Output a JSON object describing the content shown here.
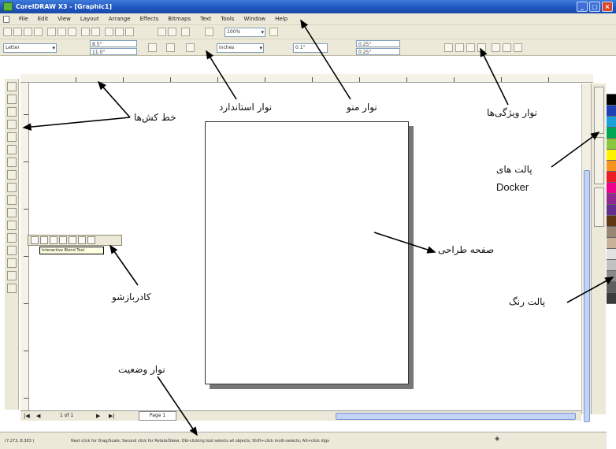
{
  "window": {
    "title": "CorelDRAW X3 - [Graphic1]",
    "controls": [
      "_",
      "□",
      "×"
    ]
  },
  "menu": [
    "File",
    "Edit",
    "View",
    "Layout",
    "Arrange",
    "Effects",
    "Bitmaps",
    "Text",
    "Tools",
    "Window",
    "Help"
  ],
  "standard_toolbar": {
    "zoom": "100%"
  },
  "property_bar": {
    "paper": "Letter",
    "width": "8.5\"",
    "height": "11.0\"",
    "units": "inches",
    "nudge": "0.1\"",
    "dup_x": "0.25\"",
    "dup_y": "0.25\""
  },
  "flyout_tooltip": "Interactive Blend Tool",
  "page_nav": {
    "count": "1 of 1",
    "tab": "Page 1"
  },
  "status": {
    "coords": "(7.273, 8.383 )",
    "hint": "Next click for Drag/Scale; Second click for Rotate/Skew; Dbl-clicking tool selects all objects; Shift+click multi-selects; Alt+click digs"
  },
  "annotations": {
    "toolbox": "خط کش‌ها",
    "standard_toolbar": "نوار استاندارد",
    "menu_bar": "نوار منو",
    "property_bar": "نوار ویژگی‌ها",
    "docker_line1": "پالت های",
    "docker_line2": "Docker",
    "drawing_page": "صفحه طراحی",
    "flyout": "کادربازشو",
    "color_palette": "پالت رنگ",
    "status_bar": "نوار وضعیت"
  },
  "palette_colors": [
    "#ffffff",
    "#000000",
    "#1f3fb5",
    "#1b9fd8",
    "#00a651",
    "#8cc63f",
    "#fff200",
    "#f7941d",
    "#ed1c24",
    "#ec008c",
    "#92278f",
    "#662d91",
    "#603913",
    "#998675",
    "#c7b299",
    "#e1e1e1",
    "#c2c2c2",
    "#8a8a8a",
    "#5e5e5e",
    "#3b3b3b"
  ]
}
